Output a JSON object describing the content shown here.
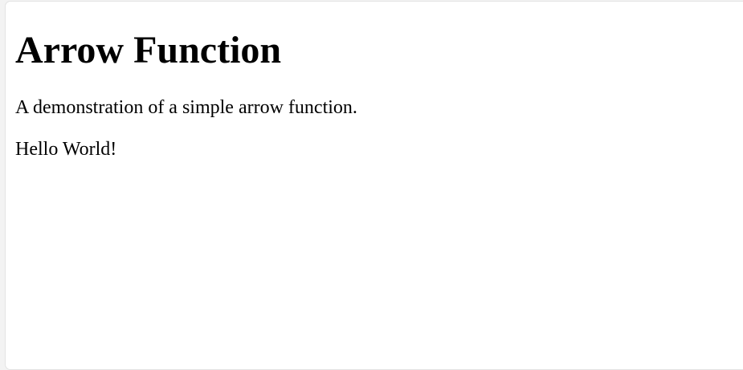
{
  "page": {
    "title": "Arrow Function",
    "description": "A demonstration of a simple arrow function.",
    "output": "Hello World!"
  }
}
